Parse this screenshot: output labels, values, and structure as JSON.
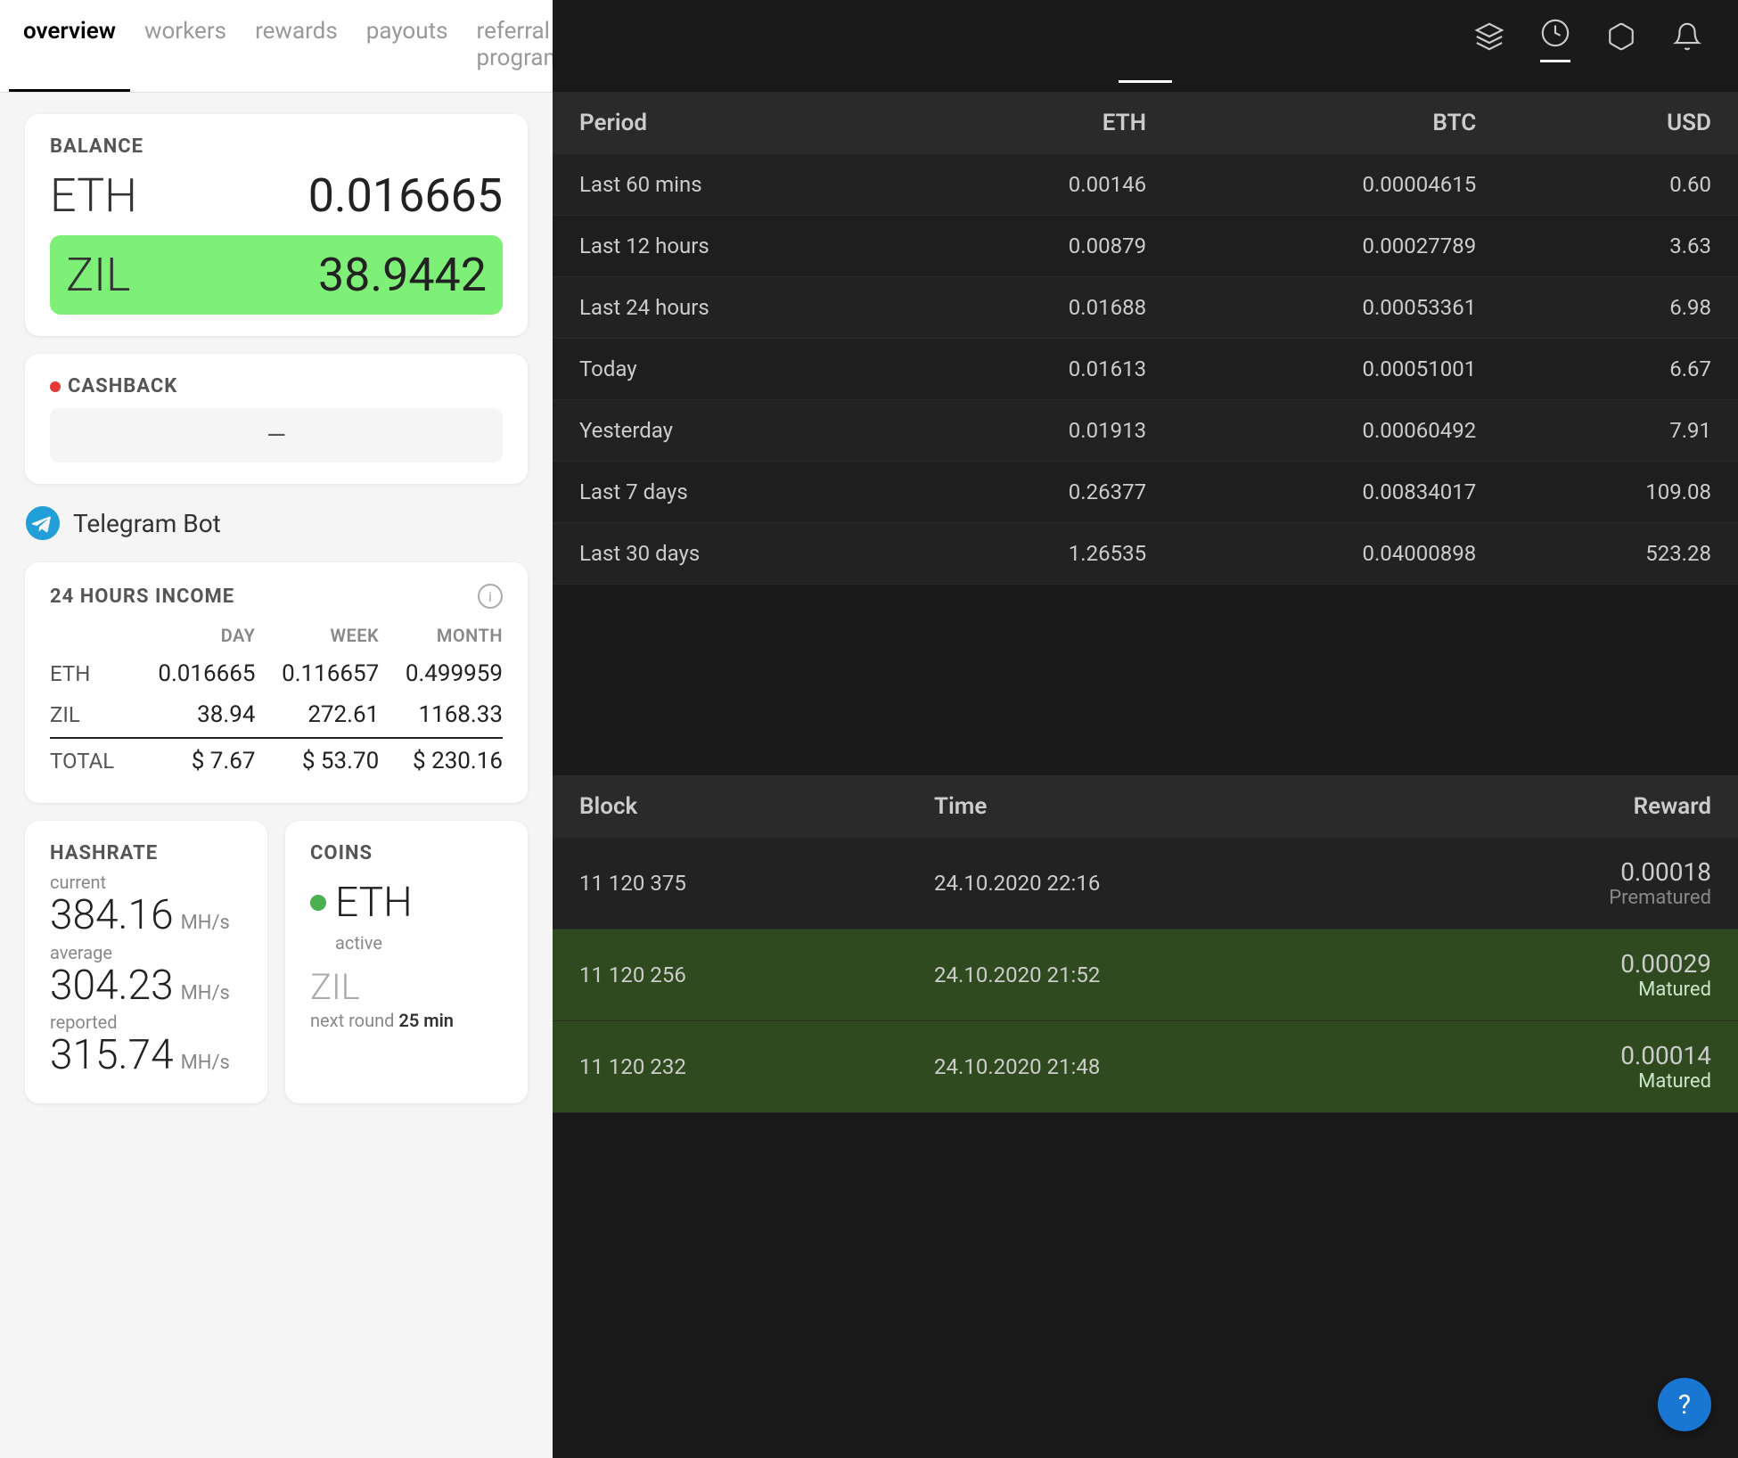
{
  "nav": {
    "tabs": [
      {
        "label": "overview",
        "active": true
      },
      {
        "label": "workers",
        "active": false
      },
      {
        "label": "rewards",
        "active": false
      },
      {
        "label": "payouts",
        "active": false
      },
      {
        "label": "referral program",
        "active": false
      }
    ]
  },
  "balance": {
    "label": "BALANCE",
    "eth_coin": "ETH",
    "eth_amount": "0.016665",
    "zil_coin": "ZIL",
    "zil_amount": "38.9442"
  },
  "cashback": {
    "label": "CASHBACK",
    "value": "—"
  },
  "telegram": {
    "label": "Telegram Bot"
  },
  "income": {
    "title": "24 HOURS INCOME",
    "columns": [
      "",
      "DAY",
      "WEEK",
      "MONTH"
    ],
    "rows": [
      {
        "coin": "ETH",
        "day": "0.016665",
        "week": "0.116657",
        "month": "0.499959"
      },
      {
        "coin": "ZIL",
        "day": "38.94",
        "week": "272.61",
        "month": "1168.33"
      },
      {
        "coin": "TOTAL",
        "day": "$ 7.67",
        "week": "$ 53.70",
        "month": "$ 230.16"
      }
    ]
  },
  "hashrate": {
    "title": "HASHRATE",
    "current_label": "current",
    "current_value": "384.16",
    "current_unit": "MH/s",
    "average_label": "average",
    "average_value": "304.23",
    "average_unit": "MH/s",
    "reported_label": "reported",
    "reported_value": "315.74",
    "reported_unit": "MH/s"
  },
  "coins": {
    "title": "COINS",
    "eth_name": "ETH",
    "eth_status": "active",
    "zil_name": "ZIL",
    "zil_next_label": "next round",
    "zil_next_value": "25 min"
  },
  "right": {
    "icons": [
      "layers",
      "clock",
      "box",
      "bell"
    ],
    "active_icon_index": 1,
    "earnings_table": {
      "headers": [
        "Period",
        "ETH",
        "BTC",
        "USD"
      ],
      "rows": [
        {
          "period": "Last 60 mins",
          "eth": "0.00146",
          "btc": "0.00004615",
          "usd": "0.60"
        },
        {
          "period": "Last 12 hours",
          "eth": "0.00879",
          "btc": "0.00027789",
          "usd": "3.63"
        },
        {
          "period": "Last 24 hours",
          "eth": "0.01688",
          "btc": "0.00053361",
          "usd": "6.98"
        },
        {
          "period": "Today",
          "eth": "0.01613",
          "btc": "0.00051001",
          "usd": "6.67"
        },
        {
          "period": "Yesterday",
          "eth": "0.01913",
          "btc": "0.00060492",
          "usd": "7.91"
        },
        {
          "period": "Last 7 days",
          "eth": "0.26377",
          "btc": "0.00834017",
          "usd": "109.08"
        },
        {
          "period": "Last 30 days",
          "eth": "1.26535",
          "btc": "0.04000898",
          "usd": "523.28"
        }
      ]
    },
    "blocks_table": {
      "headers": [
        "Block",
        "Time",
        "Reward"
      ],
      "rows": [
        {
          "block": "11 120 375",
          "time": "24.10.2020 22:16",
          "reward": "0.00018",
          "status": "Prematured",
          "matured": false
        },
        {
          "block": "11 120 256",
          "time": "24.10.2020 21:52",
          "reward": "0.00029",
          "status": "Matured",
          "matured": true
        },
        {
          "block": "11 120 232",
          "time": "24.10.2020 21:48",
          "reward": "0.00014",
          "status": "Matured",
          "matured": true
        }
      ]
    }
  }
}
